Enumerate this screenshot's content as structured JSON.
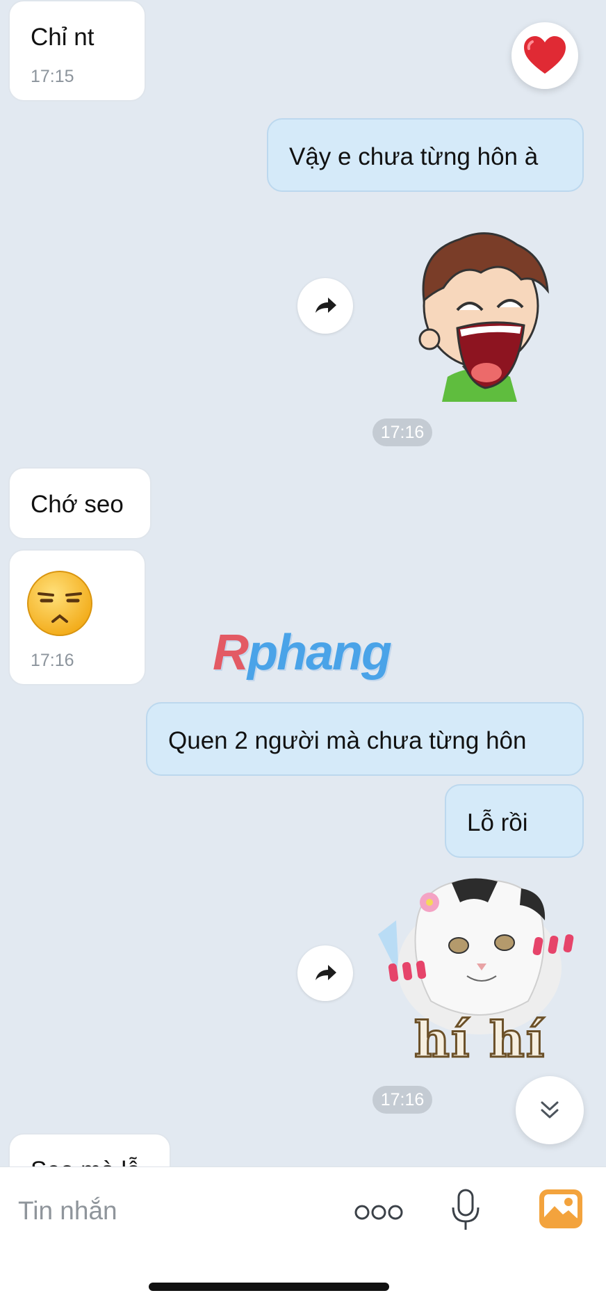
{
  "messages": [
    {
      "id": "m1",
      "side": "in",
      "text": "Chỉ nt",
      "time": "17:15"
    },
    {
      "id": "m2",
      "side": "out",
      "text": "Vậy e chưa từng hôn à"
    },
    {
      "id": "m3",
      "side": "out",
      "type": "sticker",
      "sticker": "laughing-boy-sticker"
    },
    {
      "id": "m4",
      "side": "in",
      "text": "Chớ seo"
    },
    {
      "id": "m5",
      "side": "in",
      "type": "emoji",
      "emoji": "smirk-emoji",
      "time": "17:16"
    },
    {
      "id": "m6",
      "side": "out",
      "text": "Quen 2 người mà chưa từng hôn"
    },
    {
      "id": "m7",
      "side": "out",
      "text": "Lỗ rồi"
    },
    {
      "id": "m8",
      "side": "out",
      "type": "sticker",
      "sticker": "cat-sticker",
      "caption": "hí hí"
    },
    {
      "id": "m9",
      "side": "in",
      "text": "Seo mà lỗ"
    }
  ],
  "time_pills": [
    "17:16",
    "17:16"
  ],
  "reaction": {
    "icon": "heart-icon"
  },
  "watermark": {
    "first": "R",
    "rest": "phang"
  },
  "composer": {
    "placeholder": "Tin nhắn",
    "icons": [
      "more-icon",
      "microphone-icon",
      "image-icon"
    ]
  },
  "colors": {
    "background": "#e2e9f1",
    "incoming": "#ffffff",
    "outgoing": "#d5eaf9",
    "accent": "#f3a33d"
  }
}
